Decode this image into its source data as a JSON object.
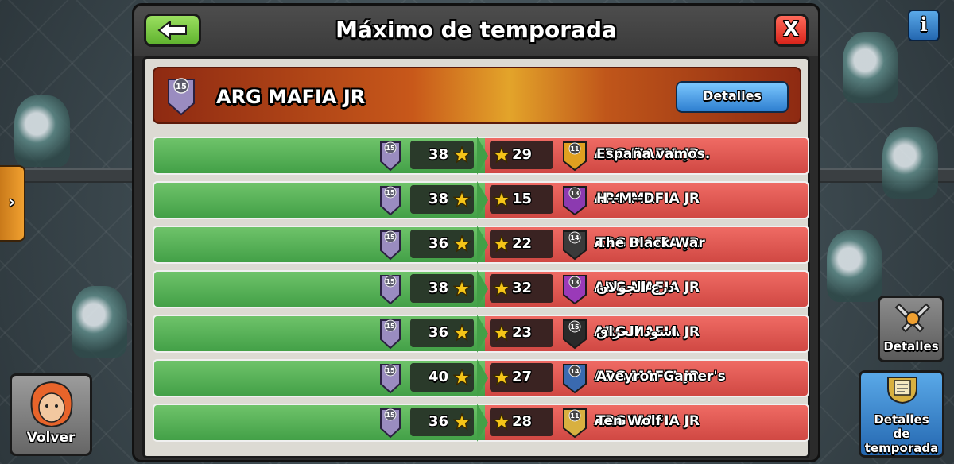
{
  "window": {
    "title": "Máximo de temporada"
  },
  "controls": {
    "back_icon": "back-arrow-icon",
    "close_label": "X",
    "info_label": "i",
    "side_tab_label": "›"
  },
  "clan": {
    "name": "ARG MAFIA JR",
    "level": "15",
    "details_label": "Detalles"
  },
  "wars": [
    {
      "left_name": "ARG MAFIA JR",
      "left_level": "15",
      "left_stars": "38",
      "right_stars": "29",
      "right_level": "11",
      "right_name": "España vamos.",
      "right_badge_color": "#e0a020"
    },
    {
      "left_name": "ARG MAFIA JR",
      "left_level": "15",
      "left_stars": "38",
      "right_stars": "15",
      "right_level": "13",
      "right_name": "H--M--D",
      "right_badge_color": "#8c3ab0"
    },
    {
      "left_name": "ARG MAFIA JR",
      "left_level": "15",
      "left_stars": "36",
      "right_stars": "22",
      "right_level": "14",
      "right_name": "The Black War",
      "right_badge_color": "#3a3a3a"
    },
    {
      "left_name": "ARG MAFIA JR",
      "left_level": "15",
      "left_stars": "38",
      "right_stars": "32",
      "right_level": "13",
      "right_name": "درع الجولان",
      "right_badge_color": "#9a3ab8"
    },
    {
      "left_name": "ARG MAFIA JR",
      "left_level": "15",
      "left_stars": "36",
      "right_stars": "23",
      "right_level": "15",
      "right_name": "اسود العراق",
      "right_badge_color": "#2a2a2a"
    },
    {
      "left_name": "ARG MAFIA JR",
      "left_level": "15",
      "left_stars": "40",
      "right_stars": "27",
      "right_level": "14",
      "right_name": "Aveyron Gamer's",
      "right_badge_color": "#3a6ab0"
    },
    {
      "left_name": "ARG MAFIA JR",
      "left_level": "15",
      "left_stars": "36",
      "right_stars": "28",
      "right_level": "11",
      "right_name": "Ten Wolf",
      "right_badge_color": "#d8b040"
    }
  ],
  "side_buttons": {
    "volver_label": "Volver",
    "detalles_label": "Detalles",
    "season_line1": "Detalles",
    "season_line2": "de",
    "season_line3": "temporada"
  },
  "colors": {
    "win_green": "#43a047",
    "loss_red": "#d04843",
    "star_gold": "#f5c518",
    "clan_badge": "#8a7bb0"
  }
}
